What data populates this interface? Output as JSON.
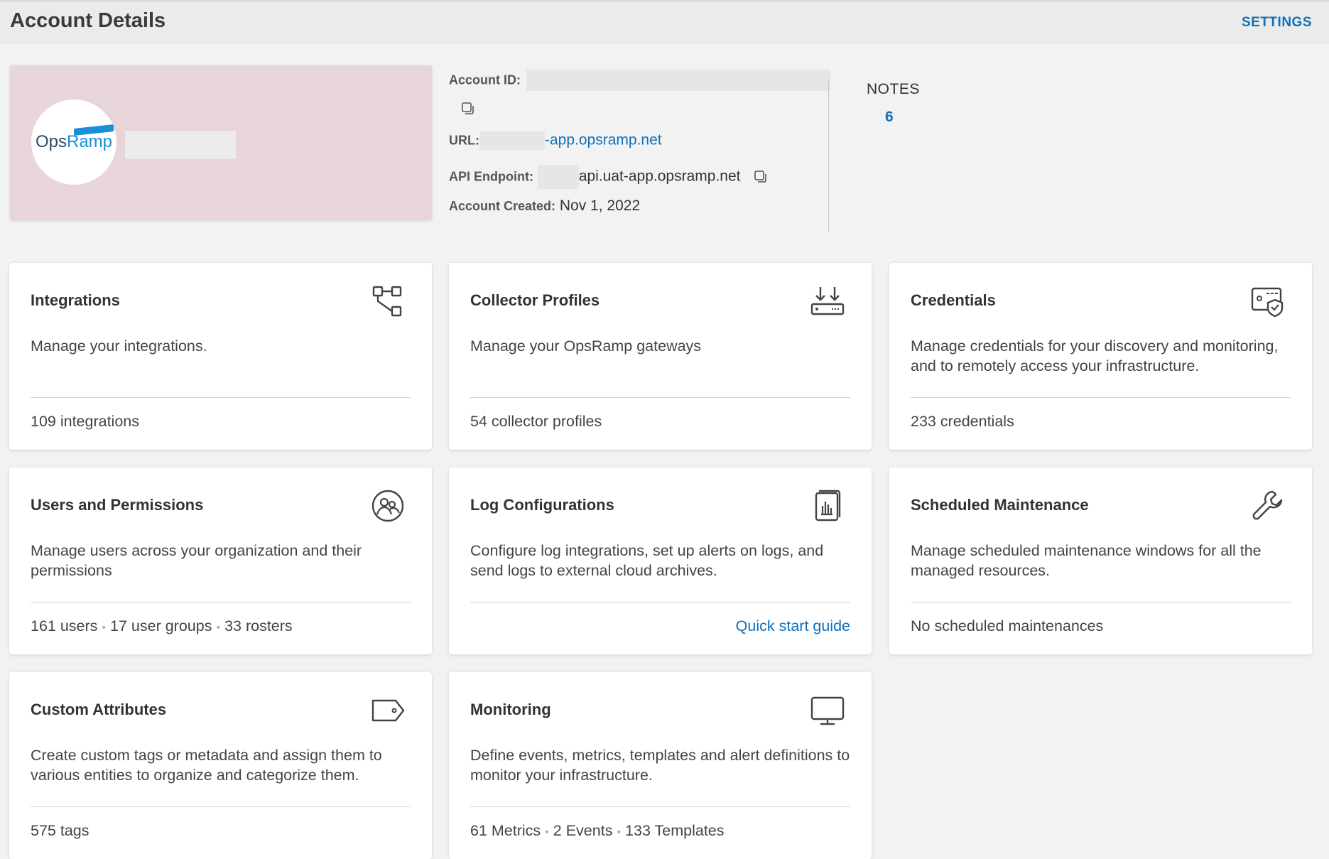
{
  "header": {
    "title": "Account Details",
    "settings_label": "SETTINGS"
  },
  "logo": {
    "part1": "Ops",
    "part2": "Ramp"
  },
  "account": {
    "id_label": "Account ID:",
    "url_label": "URL:",
    "url_value": "-app.opsramp.net",
    "api_label": "API Endpoint:",
    "api_value": "api.uat-app.opsramp.net",
    "created_label": "Account Created:",
    "created_value": "Nov 1, 2022"
  },
  "notes": {
    "label": "NOTES",
    "count": "6"
  },
  "cards": [
    {
      "title": "Integrations",
      "icon": "integrations-icon",
      "desc": "Manage your integrations.",
      "footer": [
        "109 integrations"
      ]
    },
    {
      "title": "Collector Profiles",
      "icon": "gateway-icon",
      "desc": "Manage your OpsRamp gateways",
      "footer": [
        "54 collector profiles"
      ]
    },
    {
      "title": "Credentials",
      "icon": "credentials-icon",
      "desc": "Manage credentials for your discovery and monitoring, and to remotely access your infrastructure.",
      "footer": [
        "233 credentials"
      ]
    },
    {
      "title": "Users and Permissions",
      "icon": "users-icon",
      "desc": "Manage users across your organization and their permissions",
      "footer": [
        "161 users",
        "17 user groups",
        "33 rosters"
      ]
    },
    {
      "title": "Log Configurations",
      "icon": "log-icon",
      "desc": "Configure log integrations, set up alerts on logs, and send logs to external cloud archives.",
      "footer_link": "Quick start guide"
    },
    {
      "title": "Scheduled Maintenance",
      "icon": "wrench-icon",
      "desc": "Manage scheduled maintenance windows for all the managed resources.",
      "footer": [
        "No scheduled maintenances"
      ]
    },
    {
      "title": "Custom Attributes",
      "icon": "tag-icon",
      "desc": "Create custom tags or metadata and assign them to various entities to organize and categorize them.",
      "footer": [
        "575 tags"
      ]
    },
    {
      "title": "Monitoring",
      "icon": "monitor-icon",
      "desc": "Define events, metrics, templates and alert definitions to monitor your infrastructure.",
      "footer": [
        "61 Metrics",
        "2 Events",
        "133 Templates"
      ]
    }
  ]
}
